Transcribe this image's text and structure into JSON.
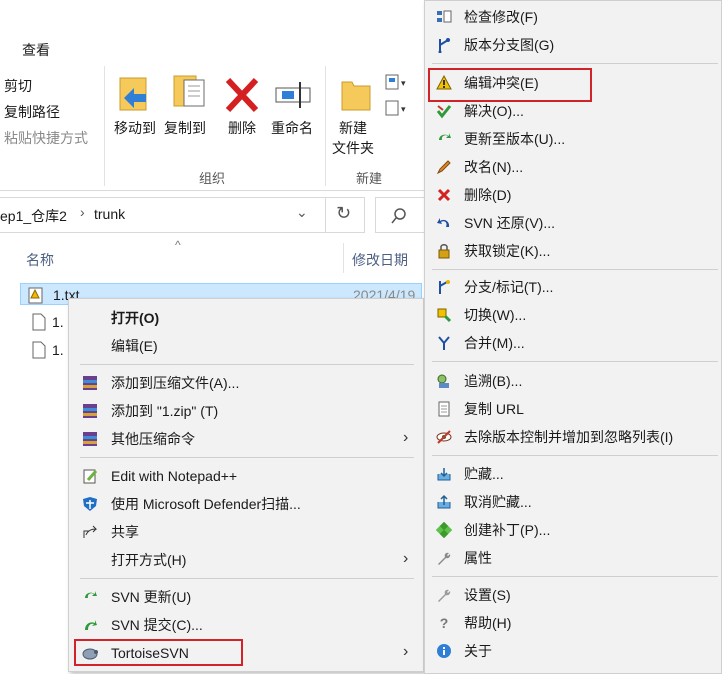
{
  "ribbon": {
    "tab_view": "查看",
    "clipboard": [
      "剪切",
      "复制路径",
      "粘贴快捷方式"
    ],
    "organize": {
      "move_to": "移动到",
      "copy_to": "复制到",
      "delete": "删除",
      "rename": "重命名",
      "group": "组织"
    },
    "new": {
      "new_folder_1": "新建",
      "new_folder_2": "文件夹",
      "group": "新建"
    }
  },
  "address": {
    "path_part1": "ep1_仓库2",
    "sep": "›",
    "path_part2": "trunk"
  },
  "columns": {
    "name": "名称",
    "modified": "修改日期"
  },
  "files": [
    {
      "name": "1.txt",
      "date": "2021/4/19"
    },
    {
      "name": "1.",
      "date": ""
    },
    {
      "name": "1.",
      "date": ""
    }
  ],
  "context_menu": {
    "open": "打开(O)",
    "edit": "编辑(E)",
    "add_archive": "添加到压缩文件(A)...",
    "add_zip": "添加到 \"1.zip\" (T)",
    "other_compress": "其他压缩命令",
    "notepad": "Edit with Notepad++",
    "defender": "使用 Microsoft Defender扫描...",
    "share": "共享",
    "open_with": "打开方式(H)",
    "svn_update": "SVN 更新(U)",
    "svn_commit": "SVN 提交(C)...",
    "tortoise": "TortoiseSVN"
  },
  "svn_menu": {
    "check_mods": "检查修改(F)",
    "revision_graph": "版本分支图(G)",
    "edit_conflicts": "编辑冲突(E)",
    "resolve": "解决(O)...",
    "update_to_rev": "更新至版本(U)...",
    "rename": "改名(N)...",
    "delete": "删除(D)",
    "revert": "SVN 还原(V)...",
    "get_lock": "获取锁定(K)...",
    "branch_tag": "分支/标记(T)...",
    "switch": "切换(W)...",
    "merge": "合并(M)...",
    "blame": "追溯(B)...",
    "copy_url": "复制 URL",
    "unversion_ignore": "去除版本控制并增加到忽略列表(I)",
    "shelve": "贮藏...",
    "unshelve": "取消贮藏...",
    "create_patch": "创建补丁(P)...",
    "properties": "属性",
    "settings": "设置(S)",
    "help": "帮助(H)",
    "about": "关于"
  },
  "colors": {
    "highlight_box": "#d2232a",
    "selection": "#cce8ff",
    "menu_bg": "#f2f2f2"
  }
}
